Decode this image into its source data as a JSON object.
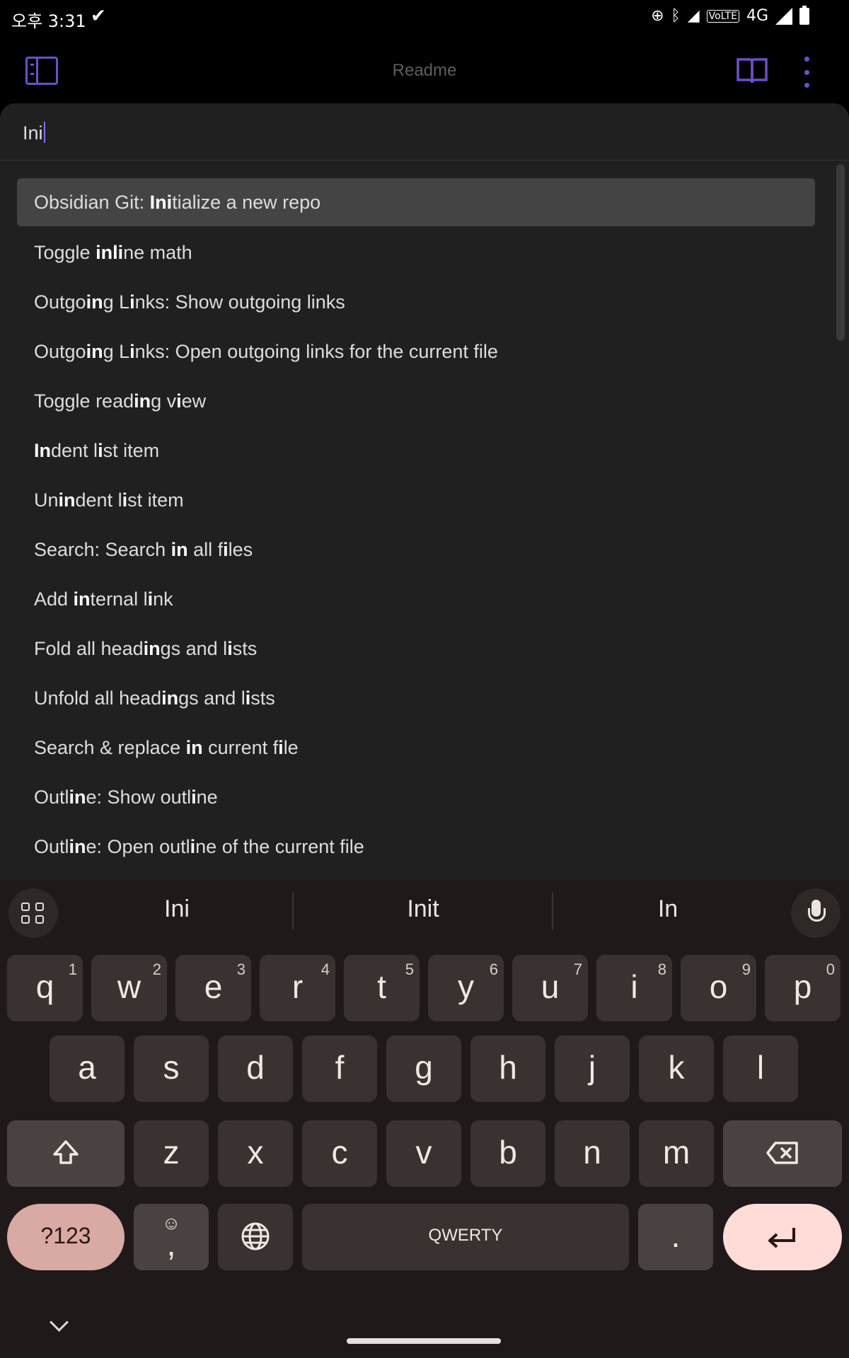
{
  "status_bar": {
    "time": "오후 3:31",
    "network": "4G",
    "volte": "VoLTE"
  },
  "header": {
    "title": "Readme"
  },
  "palette": {
    "query": "Ini",
    "items": [
      {
        "parts": [
          "Obsidian Git: ",
          "**Ini",
          "tialize a new repo"
        ],
        "selected": true
      },
      {
        "parts": [
          "Toggle ",
          "**in",
          "**li",
          "ne math"
        ]
      },
      {
        "parts": [
          "Outgo",
          "**in",
          "g L",
          "**i",
          "nks: Show outgoing links"
        ]
      },
      {
        "parts": [
          "Outgo",
          "**in",
          "g L",
          "**i",
          "nks: Open outgoing links for the current file"
        ]
      },
      {
        "parts": [
          "Toggle read",
          "**in",
          "g v",
          "**i",
          "ew"
        ]
      },
      {
        "parts": [
          "**In",
          "dent l",
          "**i",
          "st item"
        ]
      },
      {
        "parts": [
          "Un",
          "**in",
          "dent l",
          "**i",
          "st item"
        ]
      },
      {
        "parts": [
          "Search: Search ",
          "**in",
          " all f",
          "**i",
          "les"
        ]
      },
      {
        "parts": [
          "Add ",
          "**in",
          "ternal l",
          "**i",
          "nk"
        ]
      },
      {
        "parts": [
          "Fold all head",
          "**in",
          "gs and l",
          "**i",
          "sts"
        ]
      },
      {
        "parts": [
          "Unfold all head",
          "**in",
          "gs and l",
          "**i",
          "sts"
        ]
      },
      {
        "parts": [
          "Search & replace ",
          "**in",
          " current f",
          "**i",
          "le"
        ]
      },
      {
        "parts": [
          "Outl",
          "**in",
          "e: Show outl",
          "**i",
          "ne"
        ]
      },
      {
        "parts": [
          "Outl",
          "**in",
          "e: Open outl",
          "**i",
          "ne of the current file"
        ]
      }
    ]
  },
  "keyboard": {
    "suggestions": [
      "Ini",
      "Init",
      "In"
    ],
    "row1": [
      {
        "k": "q",
        "n": "1"
      },
      {
        "k": "w",
        "n": "2"
      },
      {
        "k": "e",
        "n": "3"
      },
      {
        "k": "r",
        "n": "4"
      },
      {
        "k": "t",
        "n": "5"
      },
      {
        "k": "y",
        "n": "6"
      },
      {
        "k": "u",
        "n": "7"
      },
      {
        "k": "i",
        "n": "8"
      },
      {
        "k": "o",
        "n": "9"
      },
      {
        "k": "p",
        "n": "0"
      }
    ],
    "row2": [
      "a",
      "s",
      "d",
      "f",
      "g",
      "h",
      "j",
      "k",
      "l"
    ],
    "row3": [
      "z",
      "x",
      "c",
      "v",
      "b",
      "n",
      "m"
    ],
    "symbols_label": "?123",
    "comma_label": ",",
    "space_label": "QWERTY",
    "period_label": "."
  }
}
